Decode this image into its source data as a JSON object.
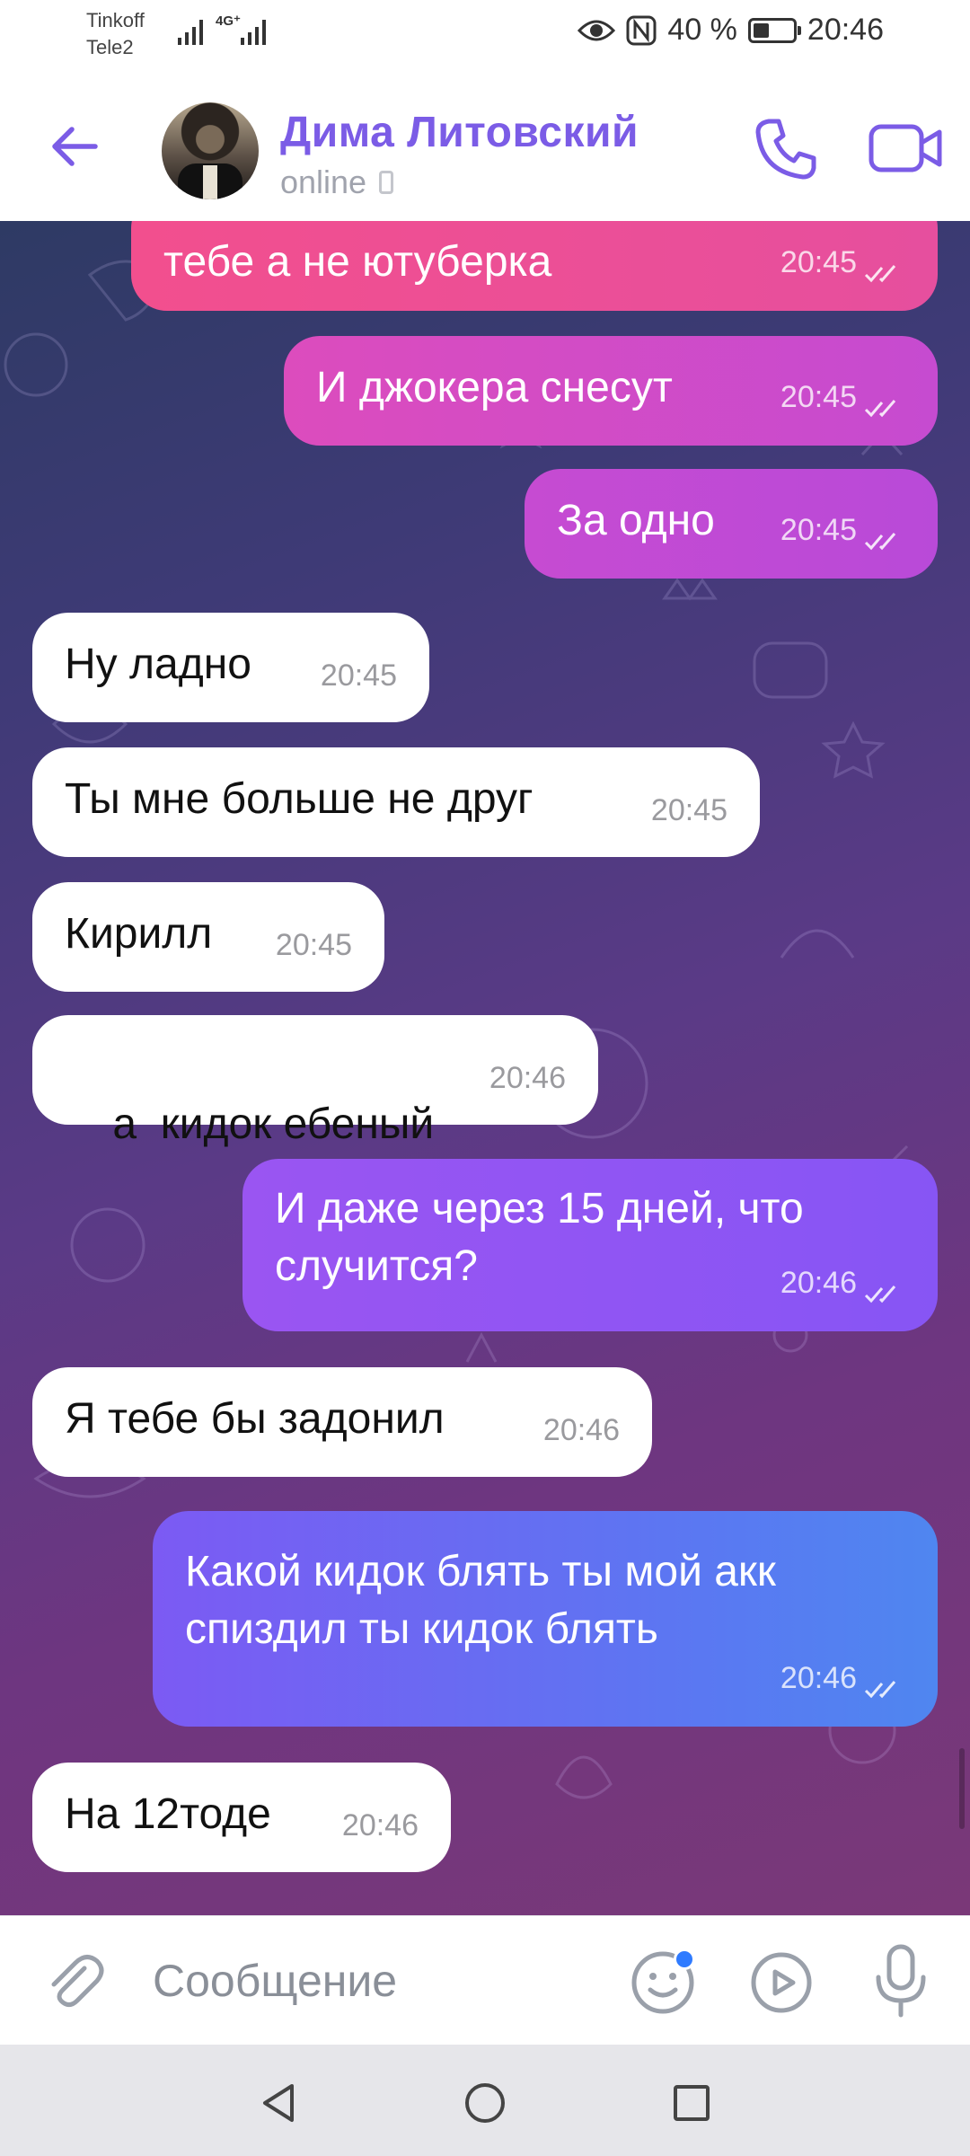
{
  "status_bar": {
    "carrier_1": "Tinkoff",
    "carrier_2": "Tele2",
    "network_label": "4G⁺",
    "battery_percent": "40 %",
    "battery_level": 0.4,
    "time": "20:46"
  },
  "header": {
    "contact_name": "Дима Литовский",
    "status": "online"
  },
  "messages": [
    {
      "direction": "out",
      "text": "тебе а не ютуберка",
      "time": "20:45",
      "read": true
    },
    {
      "direction": "out",
      "text": "И джокера снесут",
      "time": "20:45",
      "read": true
    },
    {
      "direction": "out",
      "text": "За одно",
      "time": "20:45",
      "read": true
    },
    {
      "direction": "in",
      "text": "Ну ладно",
      "time": "20:45"
    },
    {
      "direction": "in",
      "text": "Ты мне больше не друг",
      "time": "20:45"
    },
    {
      "direction": "in",
      "text": "Кирилл",
      "time": "20:45"
    },
    {
      "direction": "in",
      "text": "а  кидок ебеный",
      "time": "20:46"
    },
    {
      "direction": "out",
      "text": "И даже через 15 дней, что случится?",
      "time": "20:46",
      "read": true
    },
    {
      "direction": "in",
      "text": "Я тебе бы задонил",
      "time": "20:46"
    },
    {
      "direction": "out",
      "text": "Какой кидок блять ты мой акк спиздил ты кидок блять",
      "time": "20:46",
      "read": true
    },
    {
      "direction": "in",
      "text": "На 12тоде",
      "time": "20:46"
    }
  ],
  "input": {
    "placeholder": "Сообщение"
  },
  "colors": {
    "accent": "#7b5ce6",
    "bubble_pink": "#ef4f8c",
    "bubble_magenta": "#c84fc9",
    "bubble_purple": "#8d55f0",
    "bubble_blue": "#4f7cf2",
    "unread_dot": "#2f7bff"
  },
  "icons": {
    "back": "arrow-left-icon",
    "call": "phone-icon",
    "video": "video-camera-icon",
    "attach": "paperclip-icon",
    "emoji": "smiley-icon",
    "video_message": "play-circle-icon",
    "voice": "microphone-icon",
    "nav_back": "triangle-back-icon",
    "nav_home": "circle-home-icon",
    "nav_recents": "square-recents-icon"
  }
}
